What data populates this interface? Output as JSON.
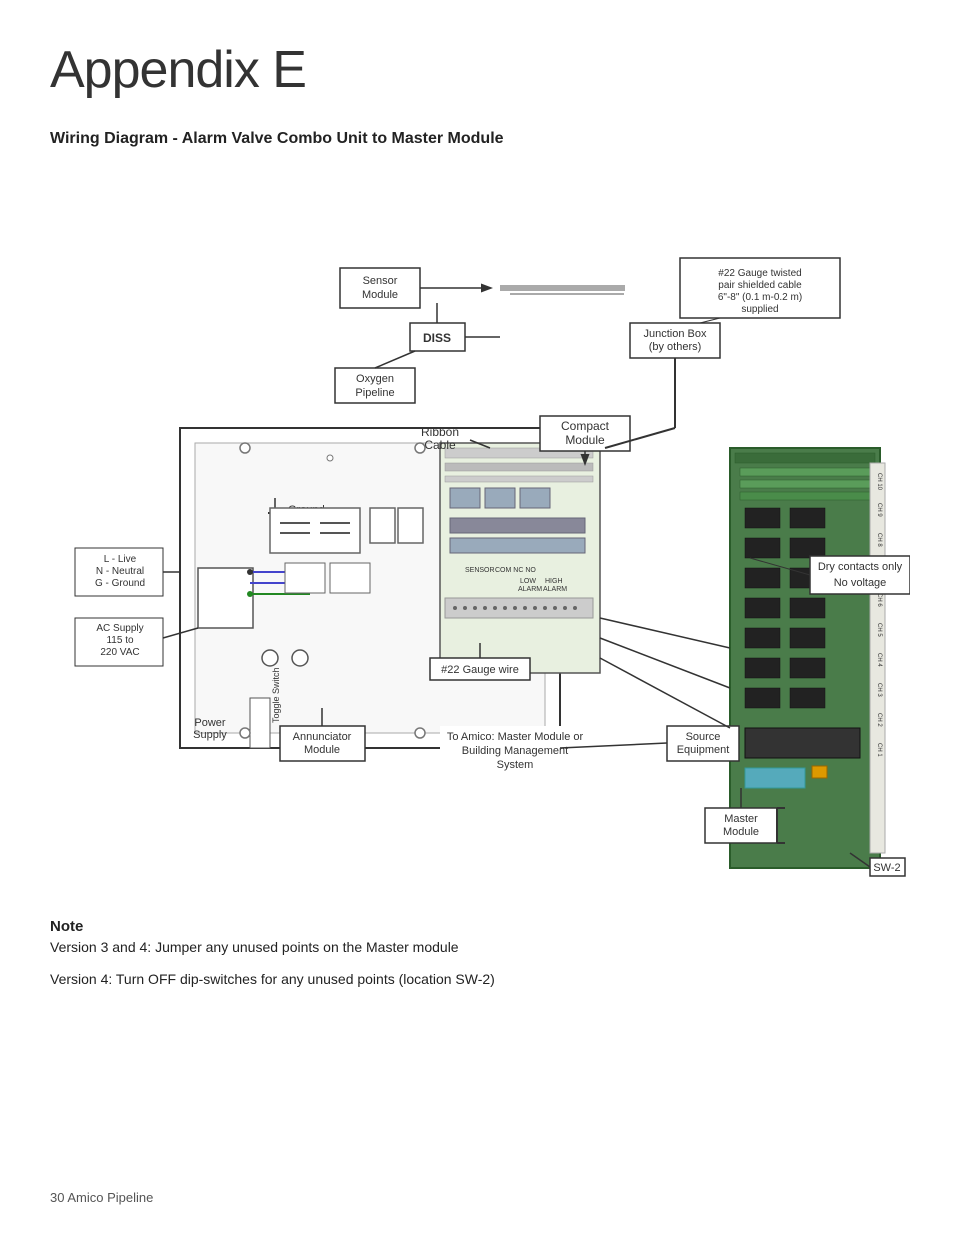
{
  "page": {
    "title": "Appendix E",
    "section_heading": "Wiring Diagram - Alarm Valve Combo Unit to Master Module",
    "note_title": "Note",
    "note1": "Version 3 and 4: Jumper any unused points on the Master module",
    "note2": "Version 4: Turn OFF dip-switches for any unused points (location SW-2)",
    "footer": "30    Amico Pipeline"
  },
  "labels": {
    "sensor_module": "Sensor Module",
    "diss": "DISS",
    "oxygen_pipeline": "Oxygen Pipeline",
    "junction_box": "Junction Box (by others)",
    "gauge_cable": "#22 Gauge twisted pair shielded cable 6\"-8\" (0.1 m-0.2 m) supplied",
    "ribbon_cable": "Ribbon Cable",
    "compact_module": "Compact Module",
    "dry_contacts": "Dry contacts only No voltage",
    "ground": "Ground",
    "live_neutral_ground": "L - Live\nN - Neutral\nG - Ground",
    "ac_supply": "AC Supply 115 to 220 VAC",
    "power_supply": "Power Supply",
    "toggle_switch": "Toggle Switch",
    "annunciator_module": "Annunciator Module",
    "gauge_wire": "#22 Gauge wire",
    "to_amico": "To Amico: Master Module or Building Management System",
    "source_equipment": "Source Equipment",
    "master_module": "Master Module",
    "sw2": "SW-2"
  }
}
